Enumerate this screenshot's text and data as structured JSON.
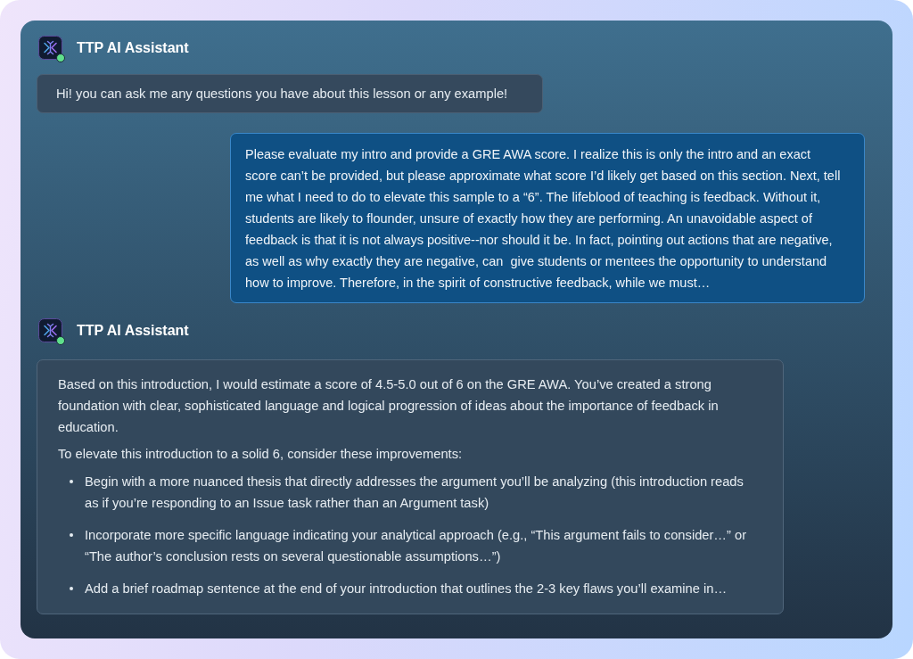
{
  "messages": [
    {
      "kind": "assistant",
      "sender": "TTP AI Assistant",
      "online": true,
      "blocks": [
        {
          "kind": "paragraph",
          "text": "Hi! you can ask me any questions you have about this lesson or any example!"
        }
      ]
    },
    {
      "kind": "user",
      "blocks": [
        {
          "kind": "paragraph",
          "text": "Please evaluate my intro and provide a GRE AWA score. I realize this is only the intro and an exact score can’t be provided, but please approximate what score I’d likely get based on this section. Next, tell me what I need to do to elevate this sample to a “6”. The lifeblood of teaching is feedback. Without it, students are likely to flounder, unsure of exactly how they are performing. An unavoidable aspect of feedback is that it is not always positive--nor should it be. In fact, pointing out actions that are negative, as well as why exactly they are negative, can  give students or mentees the opportunity to understand how to improve. Therefore, in the spirit of constructive feedback, while we must…"
        }
      ]
    },
    {
      "kind": "assistant",
      "sender": "TTP AI Assistant",
      "online": true,
      "blocks": [
        {
          "kind": "paragraph",
          "text": "Based on this introduction, I would estimate a score of 4.5-5.0 out of 6 on the GRE AWA. You’ve created a strong foundation with clear, sophisticated language and logical progression of ideas about the importance of feedback in education."
        },
        {
          "kind": "paragraph",
          "text": "To elevate this introduction to a solid 6, consider these improvements:"
        },
        {
          "kind": "bullets",
          "items": [
            "Begin with a more nuanced thesis that directly addresses the argument you’ll be analyzing (this introduction reads as if you’re responding to an Issue task rather than an Argument task)",
            "Incorporate more specific language indicating your analytical approach (e.g., “This argument fails to consider…” or “The author’s conclusion rests on several questionable assumptions…”)",
            "Add a brief roadmap sentence at the end of your introduction that outlines the 2-3 key flaws you’ll examine in…"
          ]
        }
      ]
    }
  ]
}
